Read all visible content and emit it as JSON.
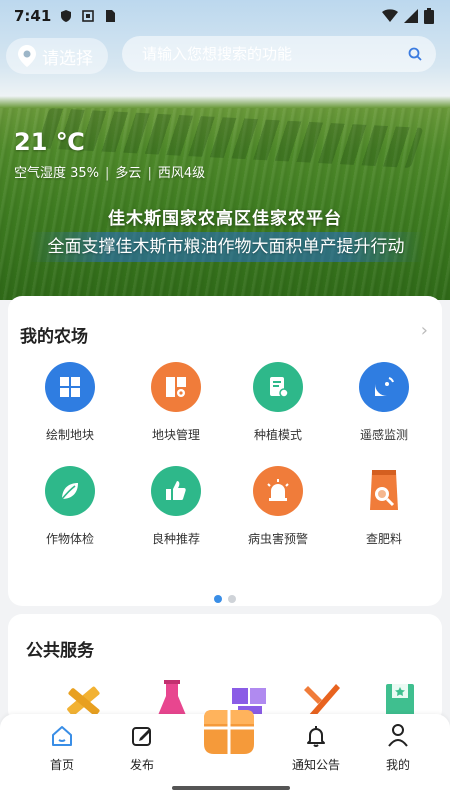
{
  "status_bar": {
    "time": "7:41"
  },
  "topbar": {
    "location_label": "请选择",
    "search_placeholder": "请输入您想搜索的功能"
  },
  "weather": {
    "temperature": "21 ℃",
    "humidity": "空气湿度 35%",
    "condition": "多云",
    "wind": "西风4级"
  },
  "hero": {
    "title": "佳木斯国家农高区佳家农平台",
    "subtitle": "全面支撑佳木斯市粮油作物大面积单产提升行动"
  },
  "farm": {
    "title": "我的农场",
    "items": [
      {
        "label": "绘制地块",
        "icon": "map-grid-icon",
        "color": "#2f7de1"
      },
      {
        "label": "地块管理",
        "icon": "plot-manage-icon",
        "color": "#f07c3a"
      },
      {
        "label": "种植模式",
        "icon": "planting-doc-icon",
        "color": "#2eb88a"
      },
      {
        "label": "遥感监测",
        "icon": "satellite-icon",
        "color": "#2f7de1"
      },
      {
        "label": "作物体检",
        "icon": "leaf-icon",
        "color": "#2eb88a"
      },
      {
        "label": "良种推荐",
        "icon": "thumb-up-icon",
        "color": "#2eb88a"
      },
      {
        "label": "病虫害预警",
        "icon": "pest-alarm-icon",
        "color": "#f07c3a"
      },
      {
        "label": "查肥料",
        "icon": "fertilizer-bag-icon",
        "color": "#f07c3a"
      }
    ],
    "page_count": 2,
    "active_page": 1
  },
  "public_services": {
    "title": "公共服务",
    "icons": [
      "tools-pencil-icon",
      "flask-icon",
      "puzzle-icon",
      "wrench-icon",
      "book-icon"
    ]
  },
  "nav": {
    "items": [
      {
        "label": "首页",
        "icon": "home-icon"
      },
      {
        "label": "发布",
        "icon": "edit-icon"
      },
      {
        "label": "通知公告",
        "icon": "bell-icon"
      },
      {
        "label": "我的",
        "icon": "user-icon"
      }
    ],
    "accent": "#3a8ee6"
  }
}
